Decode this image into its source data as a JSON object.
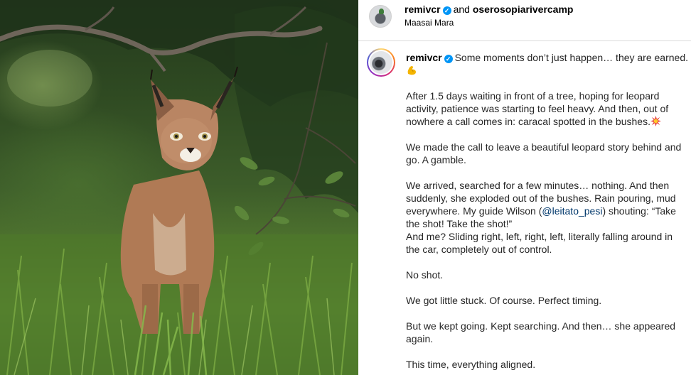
{
  "header": {
    "author": "remivcr",
    "and_text": "and",
    "collaborator": "oserosopiarivercamp",
    "location": "Maasai Mara"
  },
  "caption": {
    "author": "remivcr",
    "line1": "Some moments don’t just happen… they are earned.",
    "p2": "After 1.5 days waiting in front of a tree, hoping for leopard activity, patience was starting to feel heavy. And then, out of nowhere a call comes in: caracal spotted in the bushes.",
    "p3": "We made the call to leave a beautiful leopard story behind and go. A gamble.",
    "p4_a": "We arrived, searched for a few minutes… nothing. And then suddenly, she exploded out of the bushes. Rain pouring, mud everywhere. My guide Wilson (",
    "p4_mention": "@leitato_pesi",
    "p4_b": ") shouting: “Take the shot! Take the shot!”",
    "p4_c": "And me? Sliding right, left, right, left, literally falling around in the car, completely out of control.",
    "p5": "No shot.",
    "p6": "We got little stuck. Of course. Perfect timing.",
    "p7": "But we kept going. Kept searching. And then… she appeared again.",
    "p8": "This time, everything aligned."
  },
  "icons": {
    "verified": "verified-badge-icon",
    "muscle": "flexed-biceps-emoji",
    "collision": "collision-emoji"
  },
  "colors": {
    "verified": "#0095f6",
    "mention": "#00376b",
    "text": "#262626"
  }
}
